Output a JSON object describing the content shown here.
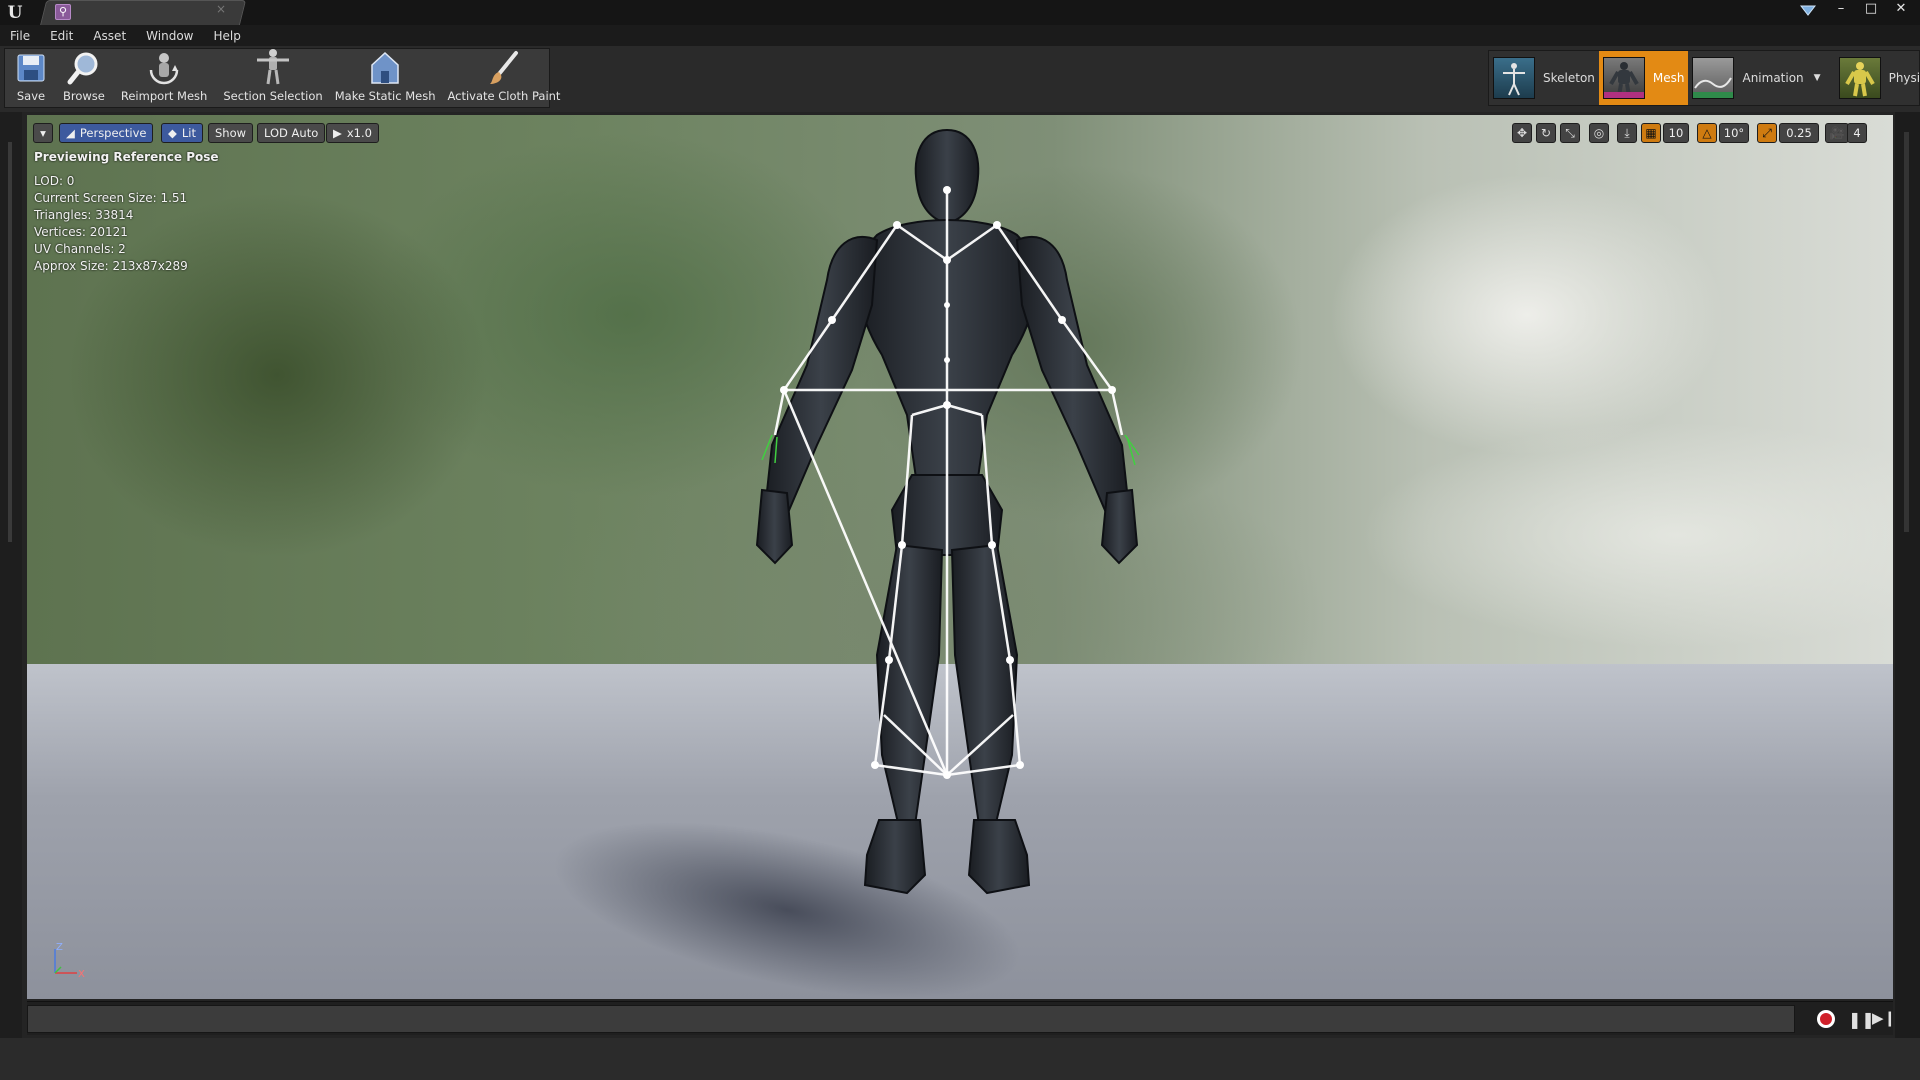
{
  "title_bar": {
    "tab_icon": "skeletal-mesh-icon",
    "tab_close_glyph": "×",
    "window_controls": [
      "–",
      "□",
      "✕"
    ]
  },
  "menu": {
    "items": [
      "File",
      "Edit",
      "Asset",
      "Window",
      "Help"
    ]
  },
  "toolbar": {
    "buttons": [
      {
        "label": "Save",
        "icon": "save-icon"
      },
      {
        "label": "Browse",
        "icon": "browse-icon"
      },
      {
        "label": "Reimport Mesh",
        "icon": "reimport-icon"
      },
      {
        "label": "Section Selection",
        "icon": "section-selection-icon"
      },
      {
        "label": "Make Static Mesh",
        "icon": "make-static-mesh-icon"
      },
      {
        "label": "Activate Cloth Paint",
        "icon": "cloth-paint-icon"
      }
    ]
  },
  "modes": {
    "skeleton": "Skeleton",
    "mesh": "Mesh",
    "animation": "Animation",
    "physics": "Physics",
    "active": "Mesh",
    "active_color": "#e38a14"
  },
  "viewport": {
    "perspective": "Perspective",
    "lit": "Lit",
    "show": "Show",
    "lod": "LOD Auto",
    "speed": "x1.0",
    "grid_snap": "10",
    "rotation_snap": "10°",
    "scale_snap": "0.25",
    "camera_speed": "4",
    "info": {
      "heading": "Previewing Reference Pose",
      "lines": [
        "LOD: 0",
        "Current Screen Size: 1.51",
        "Triangles: 33814",
        "Vertices: 20121",
        "UV Channels: 2",
        "Approx Size: 213x87x289"
      ]
    },
    "axis": {
      "z": "Z",
      "x": "X"
    }
  },
  "timeline": {
    "record_icon": "record-icon",
    "pause_icon": "pause-icon",
    "step_icon": "step-forward-icon"
  }
}
